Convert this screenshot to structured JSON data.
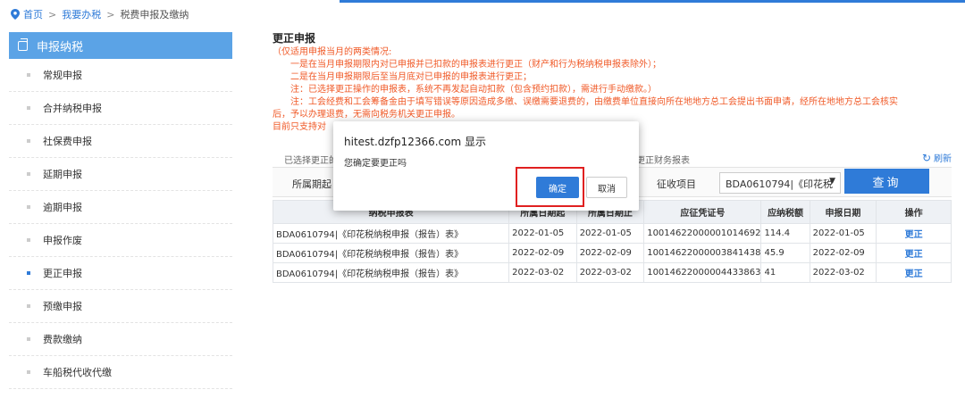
{
  "breadcrumb": {
    "home": "首页",
    "sep": ">",
    "level1": "我要办税",
    "level2": "税费申报及缴纳"
  },
  "sidebar": {
    "header": "申报纳税",
    "items": [
      {
        "label": "常规申报",
        "active": false
      },
      {
        "label": "合并纳税申报",
        "active": false
      },
      {
        "label": "社保费申报",
        "active": false
      },
      {
        "label": "延期申报",
        "active": false
      },
      {
        "label": "逾期申报",
        "active": false
      },
      {
        "label": "申报作废",
        "active": false
      },
      {
        "label": "更正申报",
        "active": true
      },
      {
        "label": "预缴申报",
        "active": false
      },
      {
        "label": "费款缴纳",
        "active": false
      },
      {
        "label": "车船税代收代缴",
        "active": false
      }
    ]
  },
  "main": {
    "title": "更正申报",
    "notes": [
      "（仅适用申报当月的两类情况:",
      "一是在当月申报期限内对已申报并已扣款的申报表进行更正（财产和行为税纳税申报表除外）；",
      "二是在当月申报期限后至当月底对已申报的申报表进行更正；",
      "注：已选择更正操作的申报表，系统不再发起自动扣款（包含预约扣款），需进行手动缴款。）",
      "注：工会经费和工会筹备金由于填写错误等原因造成多缴、误缴需要退费的，由缴费单位直接向所在地地方总工会提出书面申请，经所在地地方总工会核实",
      "后，予以办理退费，无需向税务机关更正申报。",
      "目前只支持对"
    ],
    "selected_left": "已选择更正的",
    "selected_mid": "可更正财务报表",
    "refresh": "刷新",
    "filter": {
      "period_label": "所属期起",
      "item_label": "征收项目",
      "item_value": "BDA0610794|《印花税",
      "query": "查询"
    },
    "table": {
      "headers": [
        "纳税申报表",
        "所属日期起",
        "所属日期止",
        "应征凭证号",
        "应纳税额",
        "申报日期",
        "操作"
      ],
      "rows": [
        [
          "BDA0610794|《印花税纳税申报（报告）表》",
          "2022-01-05",
          "2022-01-05",
          "10014622000001014692",
          "114.4",
          "2022-01-05",
          "更正"
        ],
        [
          "BDA0610794|《印花税纳税申报（报告）表》",
          "2022-02-09",
          "2022-02-09",
          "10014622000003841438",
          "45.9",
          "2022-02-09",
          "更正"
        ],
        [
          "BDA0610794|《印花税纳税申报（报告）表》",
          "2022-03-02",
          "2022-03-02",
          "10014622000004433863",
          "41",
          "2022-03-02",
          "更正"
        ]
      ]
    }
  },
  "dialog": {
    "title": "hitest.dzfp12366.com 显示",
    "message": "您确定要更正吗",
    "ok": "确定",
    "cancel": "取消"
  }
}
